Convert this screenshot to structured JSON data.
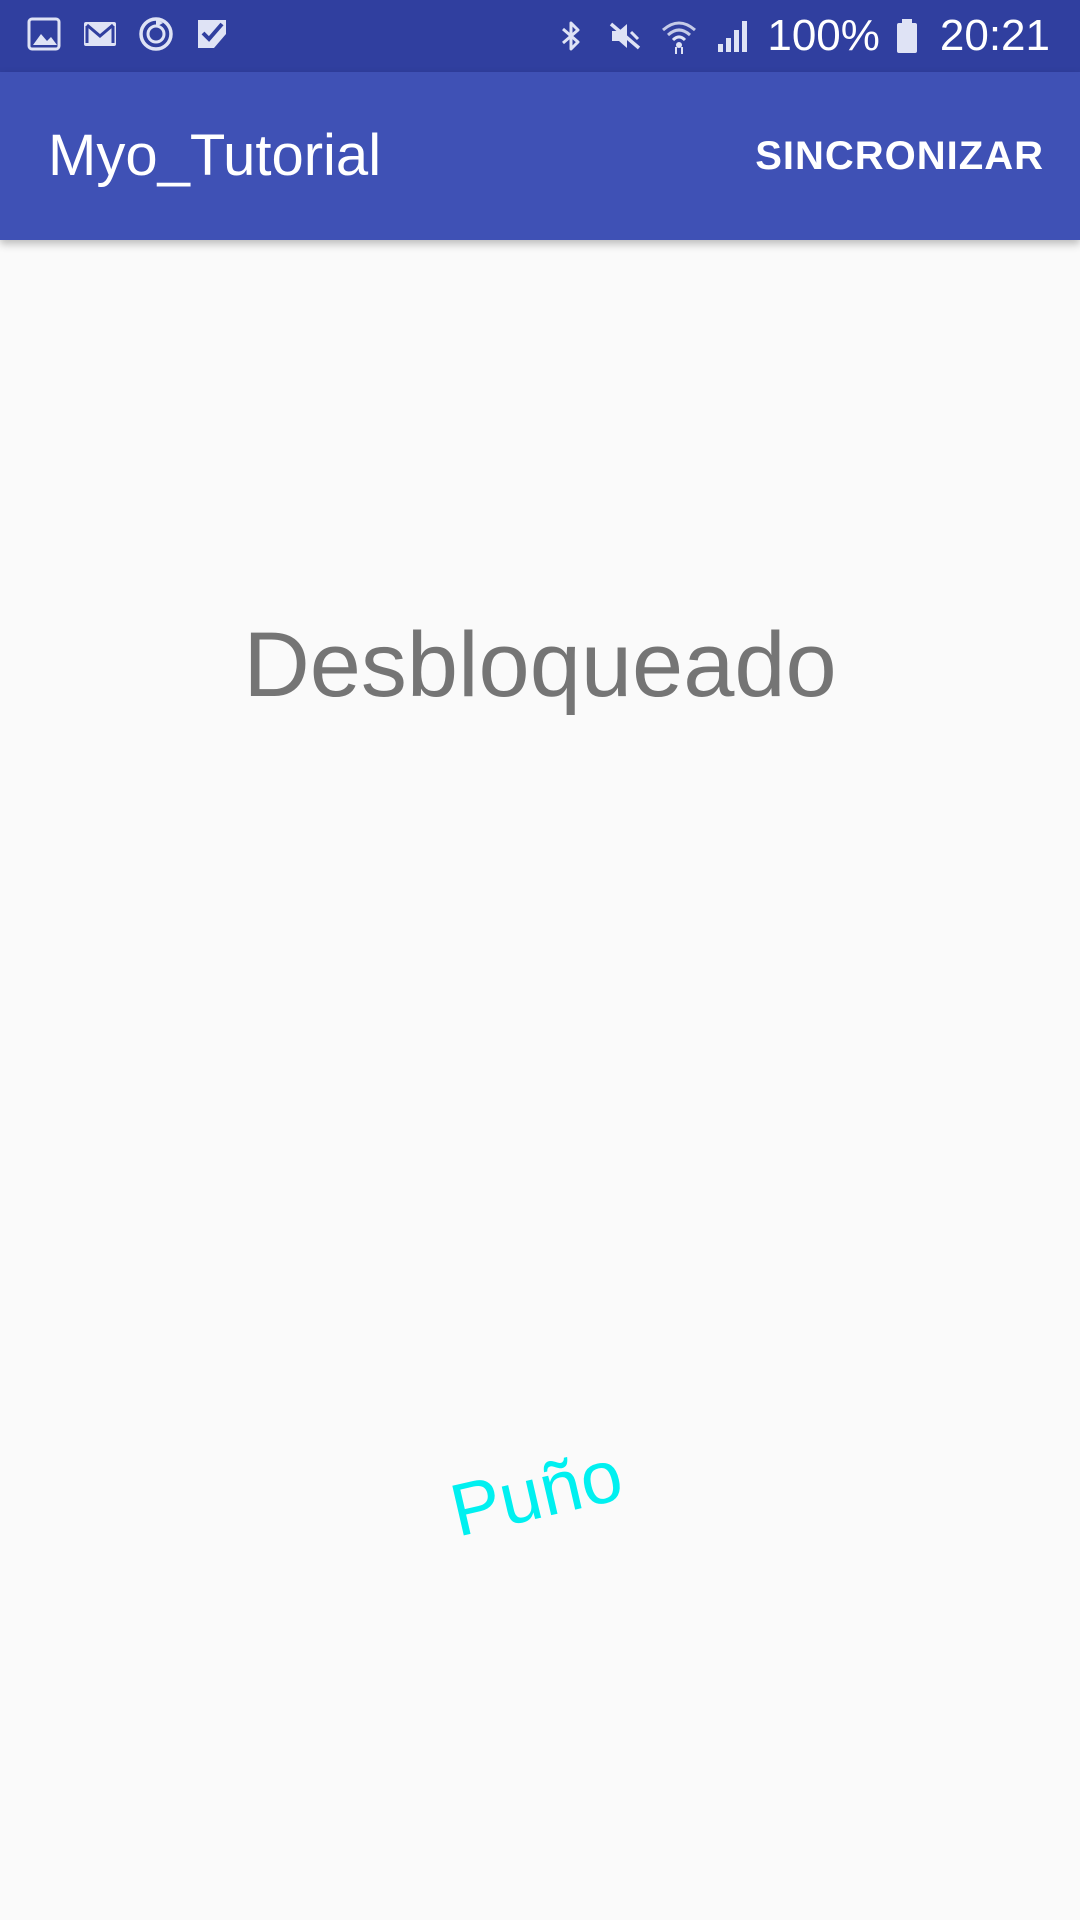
{
  "status_bar": {
    "background": "#303f9f",
    "left_icons": [
      "gallery-icon",
      "gmail-icon",
      "sync-circle-icon",
      "tasks-check-icon"
    ],
    "right_icons": [
      "bluetooth-icon",
      "mute-icon",
      "wifi-icon",
      "signal-icon",
      "battery-icon"
    ],
    "battery": "100%",
    "time": "20:21"
  },
  "app_bar": {
    "background": "#3f51b5",
    "title": "Myo_Tutorial",
    "action_label": "SINCRONIZAR"
  },
  "main": {
    "lock_status": "Desbloqueado",
    "pose": "Puño",
    "pose_color": "#00f0f0"
  }
}
